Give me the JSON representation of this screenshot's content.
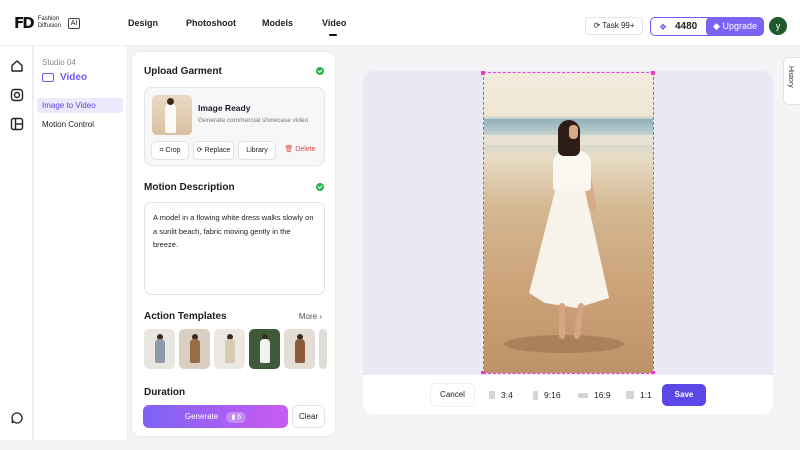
{
  "brand": {
    "mark": "FD",
    "name": "Fashion Diffusion",
    "badge": "AI"
  },
  "nav": {
    "items": [
      "Design",
      "Photoshoot",
      "Models",
      "Video"
    ],
    "active": "Video"
  },
  "header": {
    "task_label": "Task 99+",
    "credits": "4480",
    "upgrade_label": "Upgrade",
    "avatar_letter": "y"
  },
  "studio": {
    "label": "Studio 04",
    "title": "Video",
    "items": [
      {
        "label": "Image to Video",
        "active": true
      },
      {
        "label": "Motion Control",
        "active": false
      }
    ]
  },
  "upload": {
    "title": "Upload Garment",
    "status_title": "Image Ready",
    "status_sub": "Generate commercial showcase video",
    "buttons": {
      "crop": "Crop",
      "replace": "Replace",
      "library": "Library",
      "delete": "Delete"
    }
  },
  "motion": {
    "title": "Motion Description",
    "text": "A model in a flowing white dress walks slowly on a sunlit beach, fabric moving gently in the breeze."
  },
  "templates": {
    "title": "Action Templates",
    "more_label": "More"
  },
  "duration": {
    "title": "Duration"
  },
  "actions": {
    "generate_label": "Generate",
    "generate_cost": "6",
    "clear_label": "Clear"
  },
  "canvas": {
    "cancel_label": "Cancel",
    "ratios": [
      "3:4",
      "9:16",
      "16:9",
      "1:1"
    ],
    "save_label": "Save"
  },
  "history": {
    "label": "History"
  },
  "colors": {
    "accent": "#6f5cf5",
    "save": "#5b48e6",
    "crop_frame": "#f23ad2",
    "success": "#2bb24c",
    "danger": "#e04848"
  }
}
